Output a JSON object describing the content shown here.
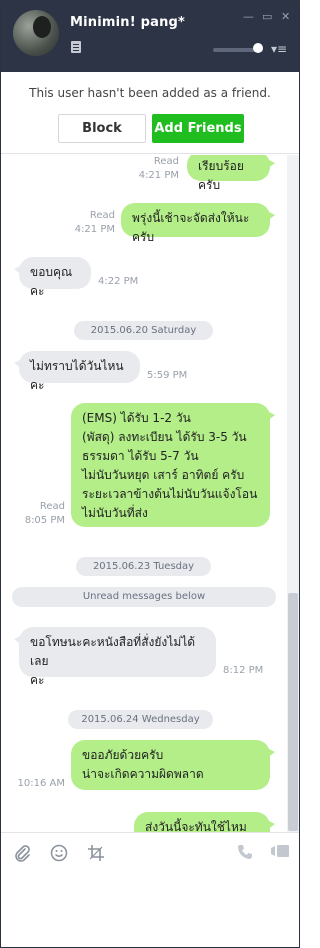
{
  "header": {
    "contact_name": "Minimin! pang*",
    "window_controls": {
      "minimize": "—",
      "maximize": "▭",
      "close": "✕"
    },
    "menu_glyph": "▾≡",
    "volume_level": 0.8
  },
  "friend_bar": {
    "message": "This user hasn't been added as a friend.",
    "block_label": "Block",
    "add_label": "Add Friends",
    "add_color": "#1fbd1f"
  },
  "chat": {
    "messages": [
      {
        "dir": "out",
        "text": "เรียบร้อยครับ",
        "read": "Read",
        "time": "4:21 PM"
      },
      {
        "dir": "out",
        "text": "พรุ่งนี้เช้าจะจัดส่งให้นะครับ",
        "read": "Read",
        "time": "4:21 PM"
      },
      {
        "dir": "in",
        "text": "ขอบคุณคะ",
        "time": "4:22 PM"
      },
      {
        "dir": "in",
        "text": "ไม่ทราบได้วันไหนคะ",
        "time": "5:59 PM"
      },
      {
        "dir": "out",
        "text": "(EMS) ได้รับ 1-2 วัน\n(พัสดุ) ลงทะเบียน ได้รับ 3-5 วัน\nธรรมดา ได้รับ 5-7 วัน\nไม่นับวันหยุด เสาร์ อาทิตย์ ครับ\nระยะเวลาข้างต้นไม่นับวันแจ้งโอน\nไม่นับวันที่ส่ง",
        "read": "Read",
        "time": "8:05 PM"
      },
      {
        "dir": "in",
        "text": "ขอโทษนะคะหนังสือที่สั่งยังไม่ได้เลย\nคะ",
        "time": "8:12 PM"
      },
      {
        "dir": "out",
        "text": "ขออภัยด้วยครับ\nน่าจะเกิดความผิดพลาด",
        "time": "10:16 AM"
      },
      {
        "dir": "out",
        "text": "ส่งวันนี้จะทันใช้ไหมครับ"
      }
    ],
    "dates": [
      "2015.06.20 Saturday",
      "2015.06.23 Tuesday",
      "2015.06.24 Wednesday"
    ],
    "unread_label": "Unread messages below"
  },
  "toolbar": {
    "attach_icon": "paperclip-icon",
    "emoji_icon": "smiley-icon",
    "crop_icon": "crop-icon",
    "call_icon": "phone-icon",
    "video_icon": "video-icon"
  },
  "colors": {
    "header_bg": "#2c3446",
    "outgoing_bubble": "#b3ee88",
    "incoming_bubble": "#e8eaee"
  }
}
